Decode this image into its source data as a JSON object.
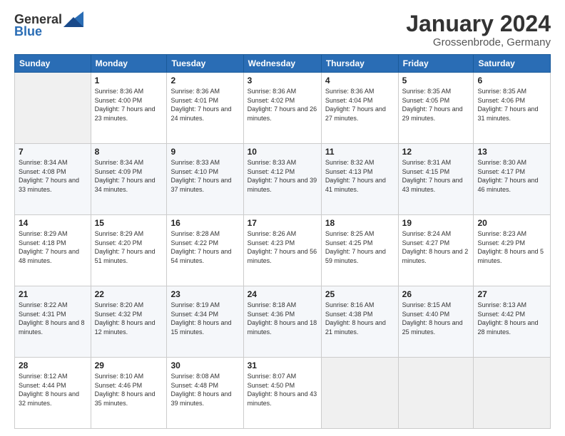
{
  "header": {
    "logo": {
      "text_general": "General",
      "text_blue": "Blue"
    },
    "title": "January 2024",
    "location": "Grossenbrode, Germany"
  },
  "weekdays": [
    "Sunday",
    "Monday",
    "Tuesday",
    "Wednesday",
    "Thursday",
    "Friday",
    "Saturday"
  ],
  "weeks": [
    [
      {
        "day": "",
        "empty": true
      },
      {
        "day": "1",
        "sunrise": "8:36 AM",
        "sunset": "4:00 PM",
        "daylight": "7 hours and 23 minutes."
      },
      {
        "day": "2",
        "sunrise": "8:36 AM",
        "sunset": "4:01 PM",
        "daylight": "7 hours and 24 minutes."
      },
      {
        "day": "3",
        "sunrise": "8:36 AM",
        "sunset": "4:02 PM",
        "daylight": "7 hours and 26 minutes."
      },
      {
        "day": "4",
        "sunrise": "8:36 AM",
        "sunset": "4:04 PM",
        "daylight": "7 hours and 27 minutes."
      },
      {
        "day": "5",
        "sunrise": "8:35 AM",
        "sunset": "4:05 PM",
        "daylight": "7 hours and 29 minutes."
      },
      {
        "day": "6",
        "sunrise": "8:35 AM",
        "sunset": "4:06 PM",
        "daylight": "7 hours and 31 minutes."
      }
    ],
    [
      {
        "day": "7",
        "sunrise": "8:34 AM",
        "sunset": "4:08 PM",
        "daylight": "7 hours and 33 minutes."
      },
      {
        "day": "8",
        "sunrise": "8:34 AM",
        "sunset": "4:09 PM",
        "daylight": "7 hours and 34 minutes."
      },
      {
        "day": "9",
        "sunrise": "8:33 AM",
        "sunset": "4:10 PM",
        "daylight": "7 hours and 37 minutes."
      },
      {
        "day": "10",
        "sunrise": "8:33 AM",
        "sunset": "4:12 PM",
        "daylight": "7 hours and 39 minutes."
      },
      {
        "day": "11",
        "sunrise": "8:32 AM",
        "sunset": "4:13 PM",
        "daylight": "7 hours and 41 minutes."
      },
      {
        "day": "12",
        "sunrise": "8:31 AM",
        "sunset": "4:15 PM",
        "daylight": "7 hours and 43 minutes."
      },
      {
        "day": "13",
        "sunrise": "8:30 AM",
        "sunset": "4:17 PM",
        "daylight": "7 hours and 46 minutes."
      }
    ],
    [
      {
        "day": "14",
        "sunrise": "8:29 AM",
        "sunset": "4:18 PM",
        "daylight": "7 hours and 48 minutes."
      },
      {
        "day": "15",
        "sunrise": "8:29 AM",
        "sunset": "4:20 PM",
        "daylight": "7 hours and 51 minutes."
      },
      {
        "day": "16",
        "sunrise": "8:28 AM",
        "sunset": "4:22 PM",
        "daylight": "7 hours and 54 minutes."
      },
      {
        "day": "17",
        "sunrise": "8:26 AM",
        "sunset": "4:23 PM",
        "daylight": "7 hours and 56 minutes."
      },
      {
        "day": "18",
        "sunrise": "8:25 AM",
        "sunset": "4:25 PM",
        "daylight": "7 hours and 59 minutes."
      },
      {
        "day": "19",
        "sunrise": "8:24 AM",
        "sunset": "4:27 PM",
        "daylight": "8 hours and 2 minutes."
      },
      {
        "day": "20",
        "sunrise": "8:23 AM",
        "sunset": "4:29 PM",
        "daylight": "8 hours and 5 minutes."
      }
    ],
    [
      {
        "day": "21",
        "sunrise": "8:22 AM",
        "sunset": "4:31 PM",
        "daylight": "8 hours and 8 minutes."
      },
      {
        "day": "22",
        "sunrise": "8:20 AM",
        "sunset": "4:32 PM",
        "daylight": "8 hours and 12 minutes."
      },
      {
        "day": "23",
        "sunrise": "8:19 AM",
        "sunset": "4:34 PM",
        "daylight": "8 hours and 15 minutes."
      },
      {
        "day": "24",
        "sunrise": "8:18 AM",
        "sunset": "4:36 PM",
        "daylight": "8 hours and 18 minutes."
      },
      {
        "day": "25",
        "sunrise": "8:16 AM",
        "sunset": "4:38 PM",
        "daylight": "8 hours and 21 minutes."
      },
      {
        "day": "26",
        "sunrise": "8:15 AM",
        "sunset": "4:40 PM",
        "daylight": "8 hours and 25 minutes."
      },
      {
        "day": "27",
        "sunrise": "8:13 AM",
        "sunset": "4:42 PM",
        "daylight": "8 hours and 28 minutes."
      }
    ],
    [
      {
        "day": "28",
        "sunrise": "8:12 AM",
        "sunset": "4:44 PM",
        "daylight": "8 hours and 32 minutes."
      },
      {
        "day": "29",
        "sunrise": "8:10 AM",
        "sunset": "4:46 PM",
        "daylight": "8 hours and 35 minutes."
      },
      {
        "day": "30",
        "sunrise": "8:08 AM",
        "sunset": "4:48 PM",
        "daylight": "8 hours and 39 minutes."
      },
      {
        "day": "31",
        "sunrise": "8:07 AM",
        "sunset": "4:50 PM",
        "daylight": "8 hours and 43 minutes."
      },
      {
        "day": "",
        "empty": true
      },
      {
        "day": "",
        "empty": true
      },
      {
        "day": "",
        "empty": true
      }
    ]
  ]
}
